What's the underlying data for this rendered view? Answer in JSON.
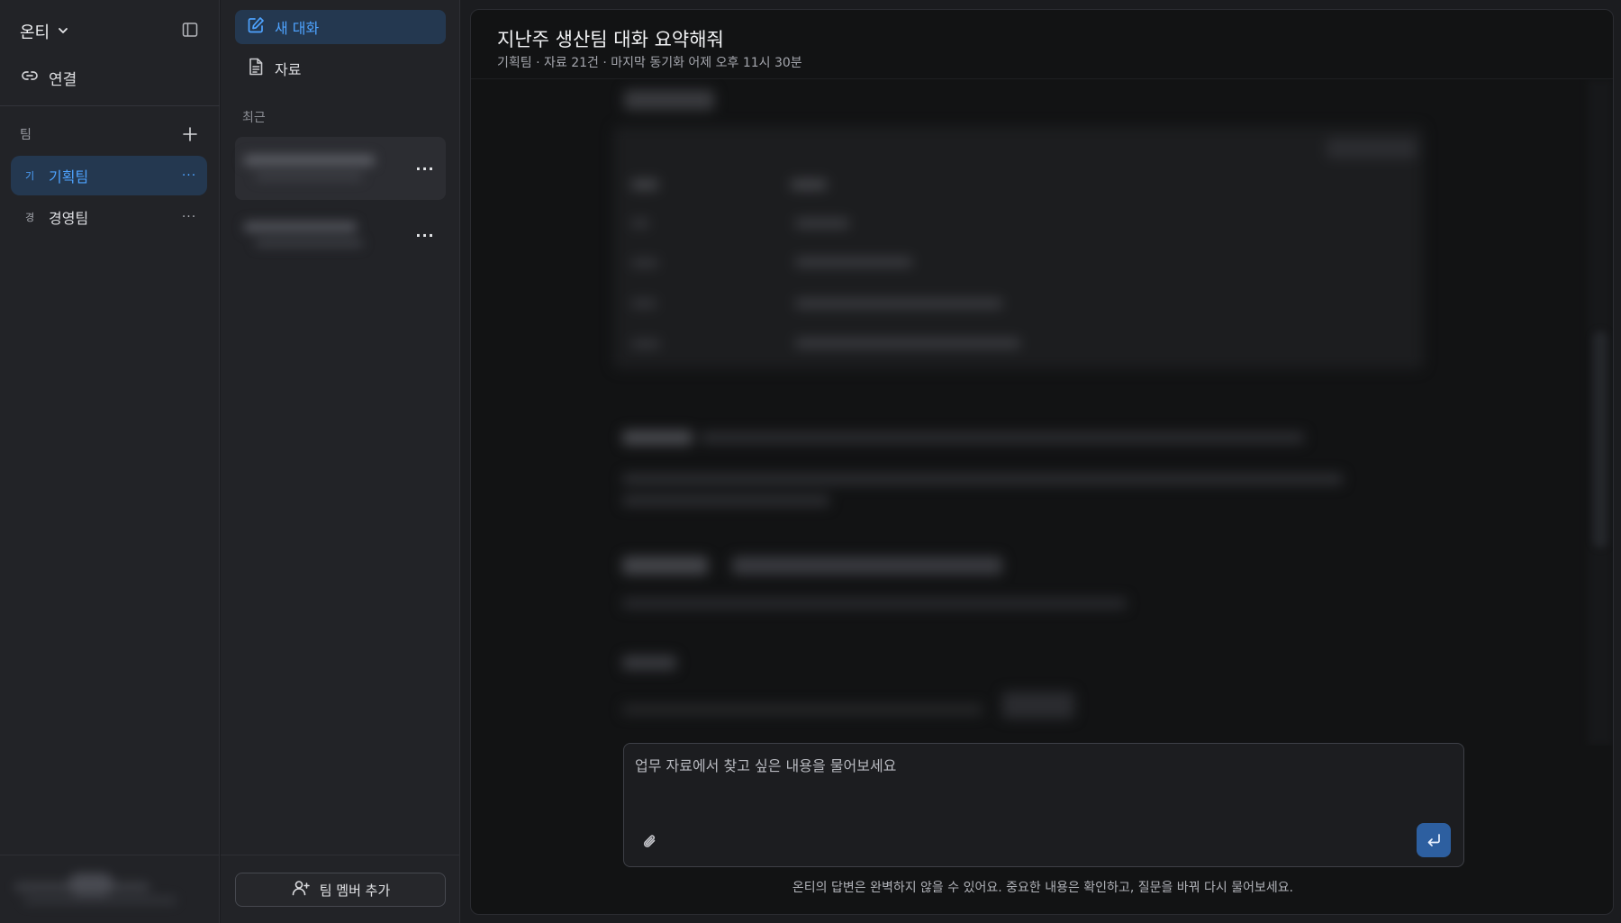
{
  "sidebar": {
    "workspace_name": "온티",
    "connect_label": "연결",
    "teams_label": "팀",
    "teams": [
      {
        "badge": "기",
        "name": "기획팀",
        "more": "···",
        "active": true
      },
      {
        "badge": "경",
        "name": "경영팀",
        "more": "···",
        "active": false
      }
    ]
  },
  "panel": {
    "new_chat_label": "새 대화",
    "docs_label": "자료",
    "recent_label": "최근",
    "recent_items": [
      {
        "more": "···"
      },
      {
        "more": "···"
      }
    ],
    "add_member_label": "팀 멤버 추가"
  },
  "main": {
    "title": "지난주 생산팀 대화 요약해줘",
    "meta": "기획팀 · 자료 21건 · 마지막 동기화 어제 오후 11시 30분",
    "composer_placeholder": "업무 자료에서 찾고 싶은 내용을 물어보세요",
    "disclaimer": "온티의 답변은 완벽하지 않을 수 있어요. 중요한 내용은 확인하고, 질문을 바꿔 다시 물어보세요."
  },
  "colors": {
    "accent": "#4ea3ff",
    "active_bg": "#243850",
    "send_button": "#2d5fa0"
  },
  "icons": [
    "chevron-down-icon",
    "sidebar-toggle-icon",
    "link-icon",
    "plus-icon",
    "edit-icon",
    "document-icon",
    "user-plus-icon",
    "paperclip-icon",
    "enter-icon"
  ]
}
